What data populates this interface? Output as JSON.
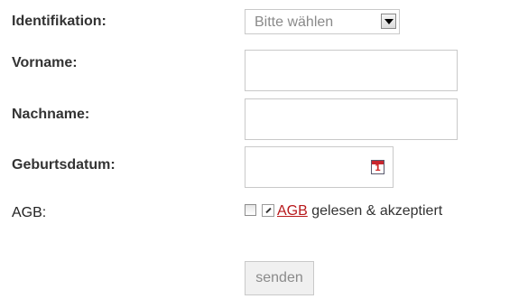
{
  "form": {
    "identification": {
      "label": "Identifikation:",
      "selected": "Bitte wählen"
    },
    "firstname": {
      "label": "Vorname:",
      "value": ""
    },
    "lastname": {
      "label": "Nachname:",
      "value": ""
    },
    "birthdate": {
      "label": "Geburtsdatum:",
      "value": "",
      "calendar_icon_digit": "1"
    },
    "terms": {
      "label": "AGB:",
      "link_text": "AGB",
      "suffix": "gelesen & akzeptiert",
      "checked": false
    },
    "submit_label": "senden"
  },
  "colors": {
    "border": "#c9c9c9",
    "link": "#b8191c",
    "placeholder_text": "#8a8a8a"
  }
}
